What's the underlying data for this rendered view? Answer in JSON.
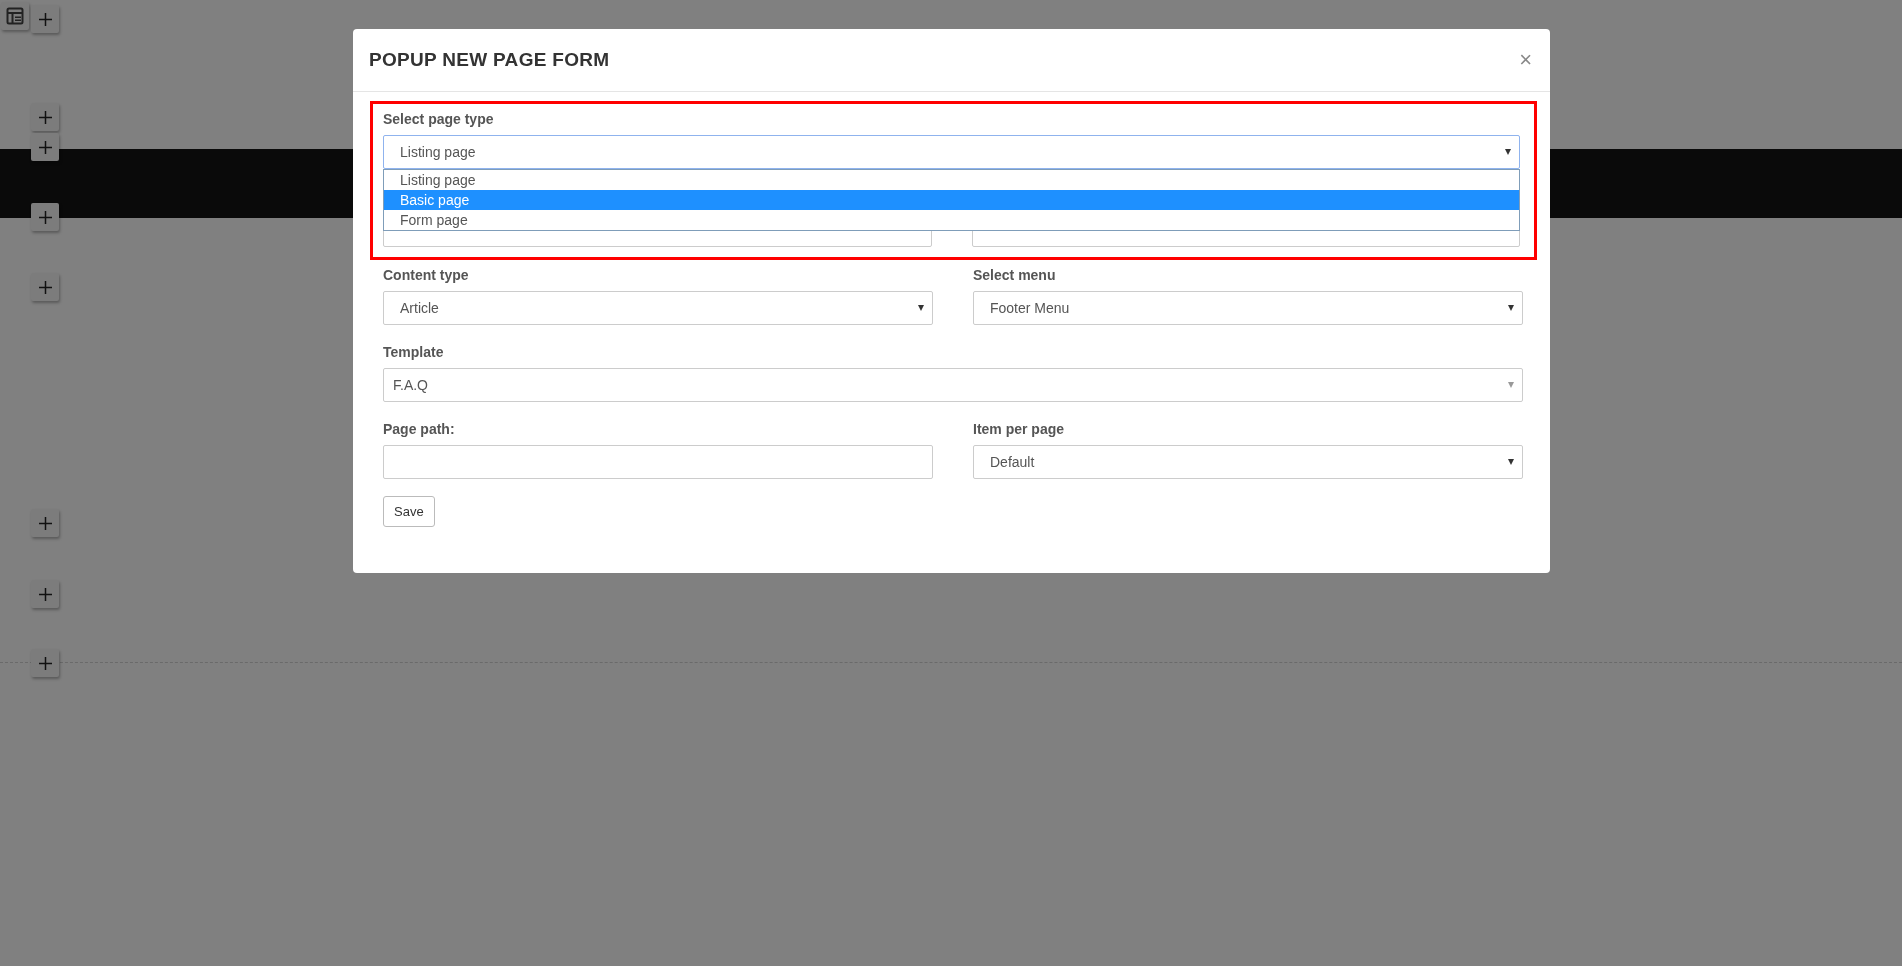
{
  "modal": {
    "title": "POPUP NEW PAGE FORM",
    "close": "×"
  },
  "page_type": {
    "label": "Select page type",
    "value": "Listing page",
    "expanded": true,
    "options": [
      {
        "label": "Listing page",
        "highlighted": false
      },
      {
        "label": "Basic page",
        "highlighted": true
      },
      {
        "label": "Form page",
        "highlighted": false
      }
    ]
  },
  "rows": [
    [
      {
        "kind": "select",
        "label": "Content type",
        "value": "Article"
      },
      {
        "kind": "select",
        "label": "Select menu",
        "value": "Footer Menu"
      }
    ],
    [
      {
        "kind": "select",
        "label": "Template",
        "value": "F.A.Q"
      }
    ],
    [
      {
        "kind": "input",
        "label": "Page path:"
      },
      {
        "kind": "select",
        "label": "Item per page",
        "value": "Default"
      }
    ]
  ],
  "save_button": "Save"
}
